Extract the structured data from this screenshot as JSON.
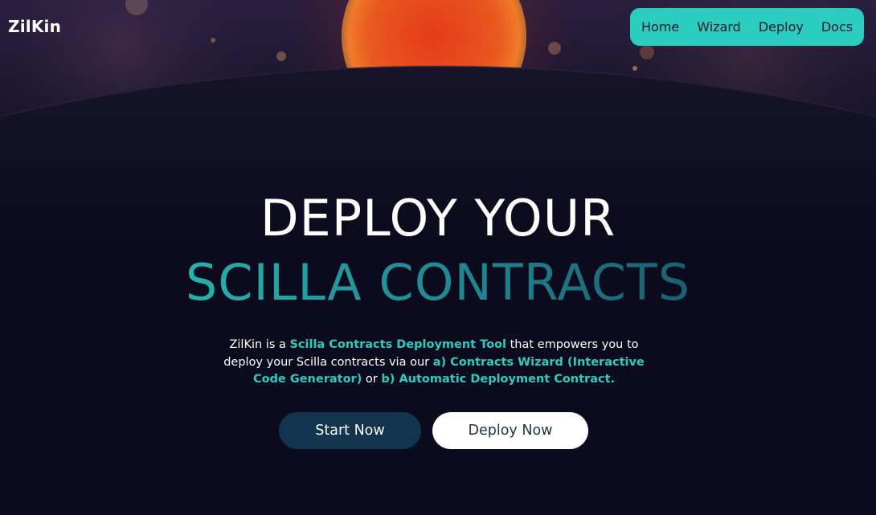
{
  "brand": {
    "name": "ZilKin"
  },
  "nav": {
    "items": [
      {
        "label": "Home"
      },
      {
        "label": "Wizard"
      },
      {
        "label": "Deploy"
      },
      {
        "label": "Docs"
      }
    ],
    "bg_color": "#2acdbf"
  },
  "hero": {
    "headline_line1": "DEPLOY YOUR",
    "headline_line2": "SCILLA CONTRACTS",
    "description": {
      "part1": "ZilKin is a ",
      "highlight1": "Scilla Contracts Deployment Tool",
      "part2": " that empowers you to deploy your Scilla contracts via our ",
      "highlight2": "a) Contracts Wizard (Interactive Code Generator)",
      "part3": " or ",
      "highlight3": "b) Automatic Deployment Contract."
    },
    "buttons": {
      "start_label": "Start Now",
      "deploy_label": "Deploy Now"
    }
  },
  "colors": {
    "background": "#0b0b1d",
    "accent": "#2acdbf",
    "start_button": "#13344f"
  }
}
